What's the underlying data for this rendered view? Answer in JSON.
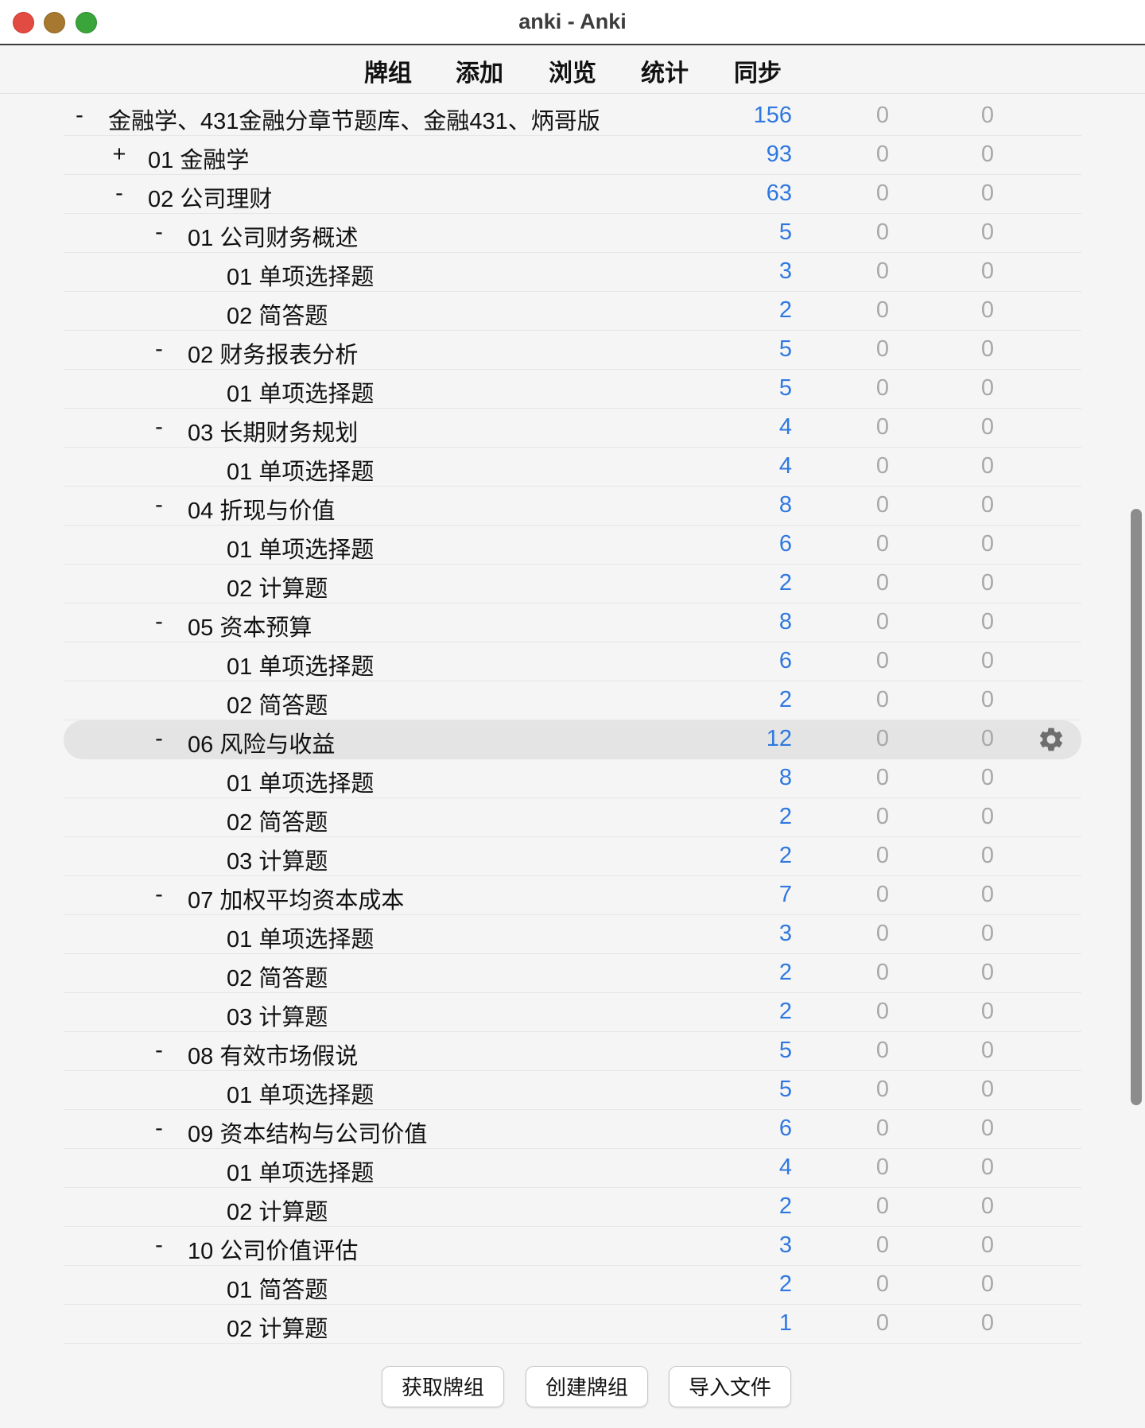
{
  "window": {
    "title": "anki - Anki"
  },
  "toolbar": {
    "decks": "牌组",
    "add": "添加",
    "browse": "浏览",
    "stats": "统计",
    "sync": "同步"
  },
  "rows": [
    {
      "toggle": "-",
      "name": "金融学、431金融分章节题库、金融431、炳哥版",
      "due": "156",
      "new": "0",
      "learn": "0"
    },
    {
      "toggle": "+",
      "name": "01 金融学",
      "due": "93",
      "new": "0",
      "learn": "0"
    },
    {
      "toggle": "-",
      "name": "02 公司理财",
      "due": "63",
      "new": "0",
      "learn": "0"
    },
    {
      "toggle": "-",
      "name": "01 公司财务概述",
      "due": "5",
      "new": "0",
      "learn": "0"
    },
    {
      "toggle": "",
      "name": "01 单项选择题",
      "due": "3",
      "new": "0",
      "learn": "0"
    },
    {
      "toggle": "",
      "name": "02 简答题",
      "due": "2",
      "new": "0",
      "learn": "0"
    },
    {
      "toggle": "-",
      "name": "02 财务报表分析",
      "due": "5",
      "new": "0",
      "learn": "0"
    },
    {
      "toggle": "",
      "name": "01 单项选择题",
      "due": "5",
      "new": "0",
      "learn": "0"
    },
    {
      "toggle": "-",
      "name": "03 长期财务规划",
      "due": "4",
      "new": "0",
      "learn": "0"
    },
    {
      "toggle": "",
      "name": "01 单项选择题",
      "due": "4",
      "new": "0",
      "learn": "0"
    },
    {
      "toggle": "-",
      "name": "04 折现与价值",
      "due": "8",
      "new": "0",
      "learn": "0"
    },
    {
      "toggle": "",
      "name": "01 单项选择题",
      "due": "6",
      "new": "0",
      "learn": "0"
    },
    {
      "toggle": "",
      "name": "02 计算题",
      "due": "2",
      "new": "0",
      "learn": "0"
    },
    {
      "toggle": "-",
      "name": "05 资本预算",
      "due": "8",
      "new": "0",
      "learn": "0"
    },
    {
      "toggle": "",
      "name": "01 单项选择题",
      "due": "6",
      "new": "0",
      "learn": "0"
    },
    {
      "toggle": "",
      "name": "02 简答题",
      "due": "2",
      "new": "0",
      "learn": "0"
    },
    {
      "toggle": "-",
      "name": "06 风险与收益",
      "due": "12",
      "new": "0",
      "learn": "0"
    },
    {
      "toggle": "",
      "name": "01 单项选择题",
      "due": "8",
      "new": "0",
      "learn": "0"
    },
    {
      "toggle": "",
      "name": "02 简答题",
      "due": "2",
      "new": "0",
      "learn": "0"
    },
    {
      "toggle": "",
      "name": "03 计算题",
      "due": "2",
      "new": "0",
      "learn": "0"
    },
    {
      "toggle": "-",
      "name": "07 加权平均资本成本",
      "due": "7",
      "new": "0",
      "learn": "0"
    },
    {
      "toggle": "",
      "name": "01 单项选择题",
      "due": "3",
      "new": "0",
      "learn": "0"
    },
    {
      "toggle": "",
      "name": "02 简答题",
      "due": "2",
      "new": "0",
      "learn": "0"
    },
    {
      "toggle": "",
      "name": "03 计算题",
      "due": "2",
      "new": "0",
      "learn": "0"
    },
    {
      "toggle": "-",
      "name": "08 有效市场假说",
      "due": "5",
      "new": "0",
      "learn": "0"
    },
    {
      "toggle": "",
      "name": "01 单项选择题",
      "due": "5",
      "new": "0",
      "learn": "0"
    },
    {
      "toggle": "-",
      "name": "09 资本结构与公司价值",
      "due": "6",
      "new": "0",
      "learn": "0"
    },
    {
      "toggle": "",
      "name": "01 单项选择题",
      "due": "4",
      "new": "0",
      "learn": "0"
    },
    {
      "toggle": "",
      "name": "02 计算题",
      "due": "2",
      "new": "0",
      "learn": "0"
    },
    {
      "toggle": "-",
      "name": "10 公司价值评估",
      "due": "3",
      "new": "0",
      "learn": "0"
    },
    {
      "toggle": "",
      "name": "01 简答题",
      "due": "2",
      "new": "0",
      "learn": "0"
    },
    {
      "toggle": "",
      "name": "02 计算题",
      "due": "1",
      "new": "0",
      "learn": "0"
    }
  ],
  "buttons": {
    "get_shared": "获取牌组",
    "create_deck": "创建牌组",
    "import_file": "导入文件"
  },
  "colors": {
    "due": "#2f78e0",
    "zero": "#a8a8a8",
    "selected_row": "#e4e4e4"
  },
  "icons": {
    "options": "gear-icon"
  }
}
